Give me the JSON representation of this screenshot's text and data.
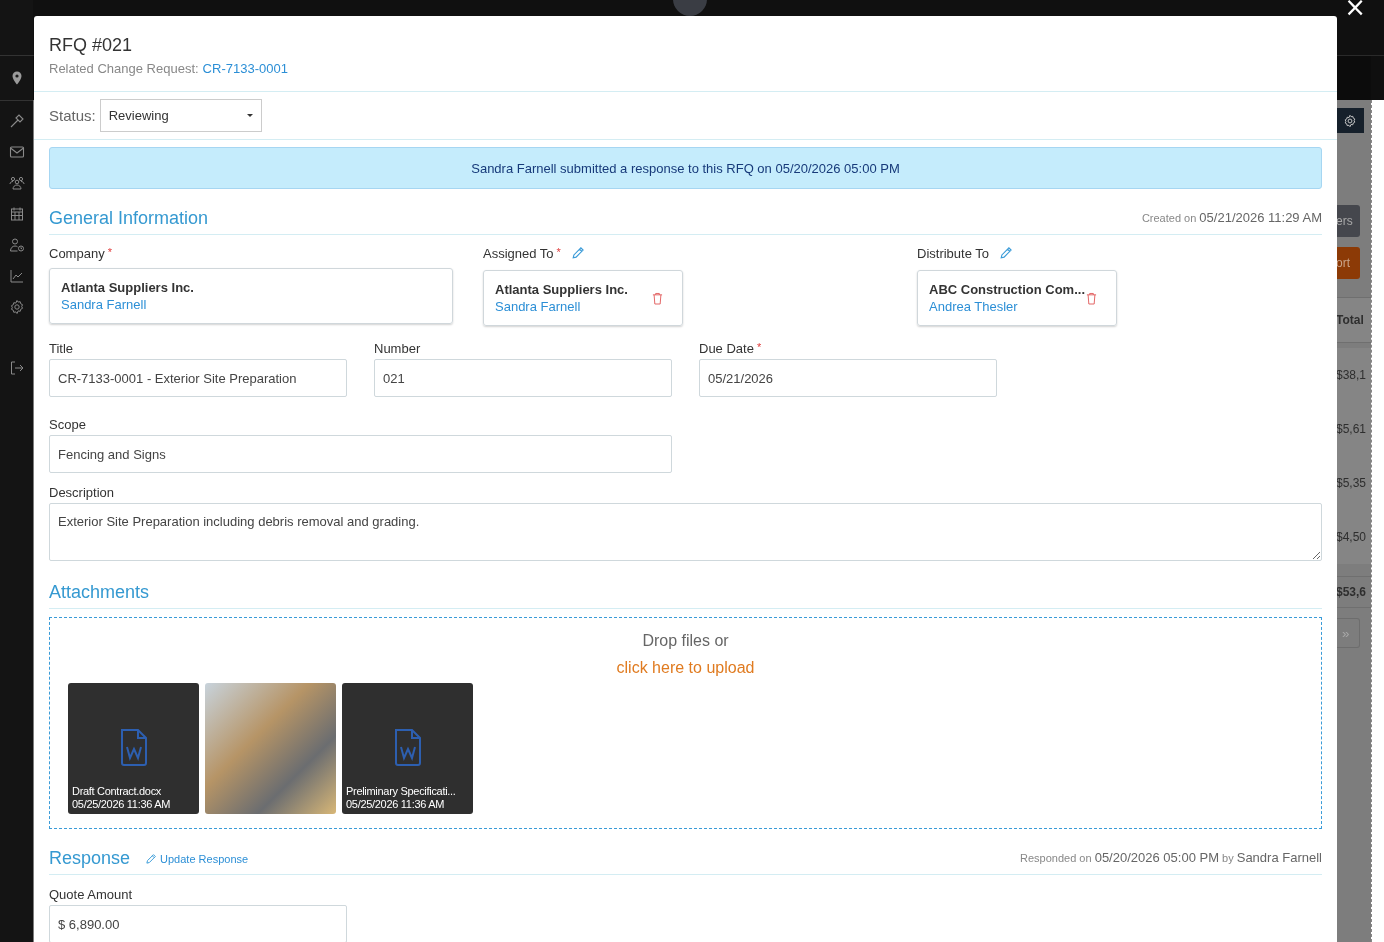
{
  "background_panel": {
    "filter_button": "ers",
    "export_button": "ort",
    "table_header": "Total",
    "row_totals": [
      "$38,1",
      "$5,61",
      "$5,35",
      "$4,50"
    ],
    "footer_total": "$53,6",
    "pager_button": "»"
  },
  "modal": {
    "title": "RFQ #021",
    "related_label": "Related Change Request:",
    "related_link": "CR-7133-0001",
    "close": "×"
  },
  "status": {
    "label": "Status:",
    "value": "Reviewing"
  },
  "alert": "Sandra Farnell submitted a response to this RFQ on 05/20/2026 05:00 PM",
  "required_mark": "*",
  "general": {
    "title": "General Information",
    "created_label": "Created on",
    "created_value": "05/21/2026 11:29 AM",
    "contacts": [
      {
        "label": "Company",
        "required": true,
        "editable": false,
        "removable": false,
        "company": "Atlanta Suppliers Inc.",
        "person": "Sandra Farnell"
      },
      {
        "label": "Assigned To",
        "required": true,
        "editable": true,
        "removable": true,
        "company": "Atlanta Suppliers Inc.",
        "person": "Sandra Farnell"
      },
      {
        "label": "Distribute To",
        "required": false,
        "editable": true,
        "removable": true,
        "company": "ABC Construction Com...",
        "person": "Andrea Thesler"
      }
    ],
    "fields": [
      {
        "kind": "text",
        "label": "Title",
        "required": false,
        "value": "CR-7133-0001 - Exterior Site Preparation"
      },
      {
        "kind": "text",
        "label": "Number",
        "required": false,
        "value": "021"
      },
      {
        "kind": "text",
        "label": "Due Date",
        "required": true,
        "value": "05/21/2026"
      },
      {
        "kind": "text-wide",
        "label": "Scope",
        "required": false,
        "value": "Fencing and Signs"
      },
      {
        "kind": "textarea",
        "label": "Description",
        "required": false,
        "value": "Exterior Site Preparation including debris removal and grading."
      }
    ]
  },
  "attachments": {
    "title": "Attachments",
    "drop_text": "Drop files or",
    "upload_link": "click here to upload",
    "files": [
      {
        "kind": "document",
        "name": "Draft Contract.docx",
        "date": "05/25/2026 11:36 AM"
      },
      {
        "kind": "photo"
      },
      {
        "kind": "document",
        "name": "Preliminary Specificati...",
        "date": "05/25/2026 11:36 AM"
      }
    ]
  },
  "response": {
    "title": "Response",
    "update_link": "Update Response",
    "responded_label": "Responded on",
    "responded_value": "05/20/2026 05:00 PM",
    "by_label": "by",
    "by_value": "Sandra Farnell",
    "fields": [
      {
        "label": "Quote Amount",
        "value": "$ 6,890.00"
      }
    ]
  }
}
